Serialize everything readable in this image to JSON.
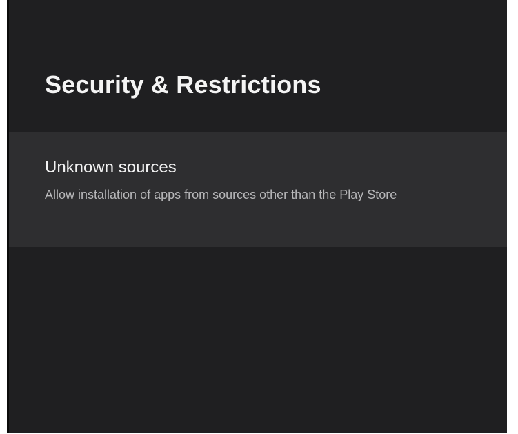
{
  "header": {
    "title": "Security & Restrictions"
  },
  "settings": {
    "items": [
      {
        "title": "Unknown sources",
        "summary": "Allow installation of apps from sources other than the Play Store"
      }
    ]
  },
  "colors": {
    "background": "#1f1f21",
    "focused_item": "#2e2e30",
    "title_text": "#f4f4f4",
    "summary_text": "#b7b7b9"
  }
}
